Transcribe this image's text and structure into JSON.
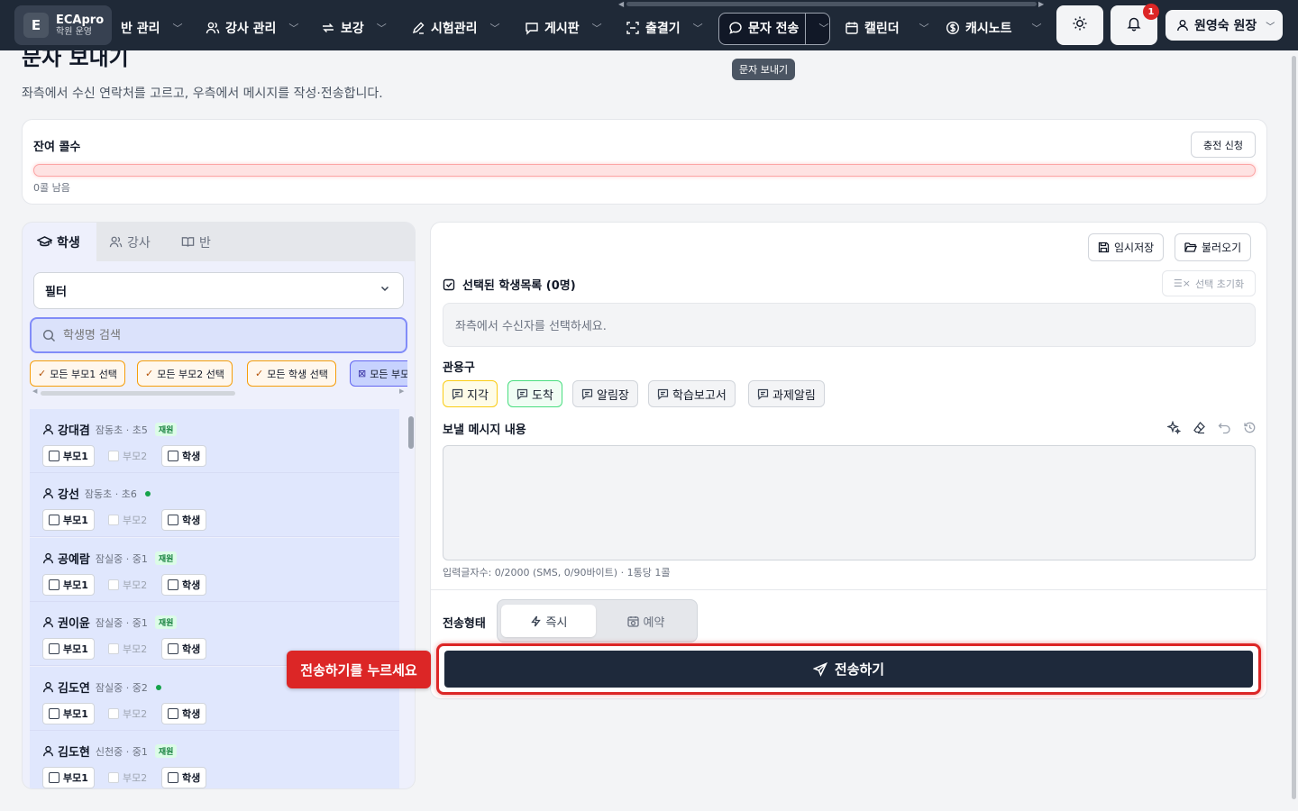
{
  "brand": {
    "logo_letter": "E",
    "name": "ECApro",
    "subtitle": "학원 운영"
  },
  "nav": {
    "items": [
      {
        "label": "반 관리",
        "icon": "partial"
      },
      {
        "label": "강사 관리",
        "icon": "users-icon"
      },
      {
        "label": "보강",
        "icon": "repeat-icon"
      },
      {
        "label": "시험관리",
        "icon": "pencil-icon"
      },
      {
        "label": "게시판",
        "icon": "chat-icon"
      },
      {
        "label": "출결기",
        "icon": "scan-icon"
      },
      {
        "label": "문자 전송",
        "icon": "message-icon"
      },
      {
        "label": "캘린더",
        "icon": "calendar-icon"
      },
      {
        "label": "캐시노트",
        "icon": "dollar-icon"
      }
    ],
    "notification_count": "1",
    "user_label": "원영숙 원장",
    "tooltip": "문자 보내기"
  },
  "page": {
    "title": "문자 보내기",
    "subtitle": "좌측에서 수신 연락처를 고르고, 우측에서 메시지를 작성·전송합니다."
  },
  "credits": {
    "label": "잔여 콜수",
    "charge_button": "충전 신청",
    "remaining_text": "0콜 남음",
    "fill_fraction": 0
  },
  "left": {
    "tabs": [
      {
        "label": "학생",
        "icon": "graduation-cap-icon",
        "active": true
      },
      {
        "label": "강사",
        "icon": "users-icon",
        "active": false
      },
      {
        "label": "반",
        "icon": "book-icon",
        "active": false
      }
    ],
    "filter_label": "필터",
    "search_placeholder": "학생명 검색",
    "quick_selects": [
      "모든 부모1 선택",
      "모든 부모2 선택",
      "모든 학생 선택",
      "모든 부모"
    ],
    "checkbox_labels": {
      "parent1": "부모1",
      "parent2": "부모2",
      "student": "학생"
    },
    "students": [
      {
        "name": "강대겸",
        "meta": "잠동초 · 초5",
        "badge": "재원",
        "dot": false
      },
      {
        "name": "강선",
        "meta": "잠동초 · 초6",
        "badge": "",
        "dot": true
      },
      {
        "name": "공예람",
        "meta": "잠실중 · 중1",
        "badge": "재원",
        "dot": false
      },
      {
        "name": "권이윤",
        "meta": "잠실중 · 중1",
        "badge": "재원",
        "dot": false
      },
      {
        "name": "김도연",
        "meta": "잠실중 · 중2",
        "badge": "",
        "dot": true
      },
      {
        "name": "김도현",
        "meta": "신천중 · 중1",
        "badge": "재원",
        "dot": false
      }
    ]
  },
  "right": {
    "save_draft": "임시저장",
    "load": "불러오기",
    "selected_title": "선택된 학생목록 (0명)",
    "reset_selection": "선택 초기화",
    "selected_empty": "좌측에서 수신자를 선택하세요.",
    "phrases_label": "관용구",
    "phrases": [
      {
        "label": "지각",
        "style": "yellow"
      },
      {
        "label": "도착",
        "style": "green"
      },
      {
        "label": "알림장",
        "style": "gray"
      },
      {
        "label": "학습보고서",
        "style": "gray"
      },
      {
        "label": "과제알림",
        "style": "gray"
      }
    ],
    "message_label": "보낼 메시지 내용",
    "message_value": "",
    "char_count": "입력글자수: 0/2000 (SMS, 0/90바이트) · 1통당 1콜",
    "send_mode_label": "전송형태",
    "send_modes": [
      {
        "label": "즉시",
        "active": true
      },
      {
        "label": "예약",
        "active": false
      }
    ],
    "send_button": "전송하기",
    "callout": "전송하기를 누르세요"
  },
  "colors": {
    "nav_bg": "#1f2937",
    "accent_red": "#dc2626",
    "send_bg": "#1e293b",
    "list_bg": "#e0e7fd"
  }
}
